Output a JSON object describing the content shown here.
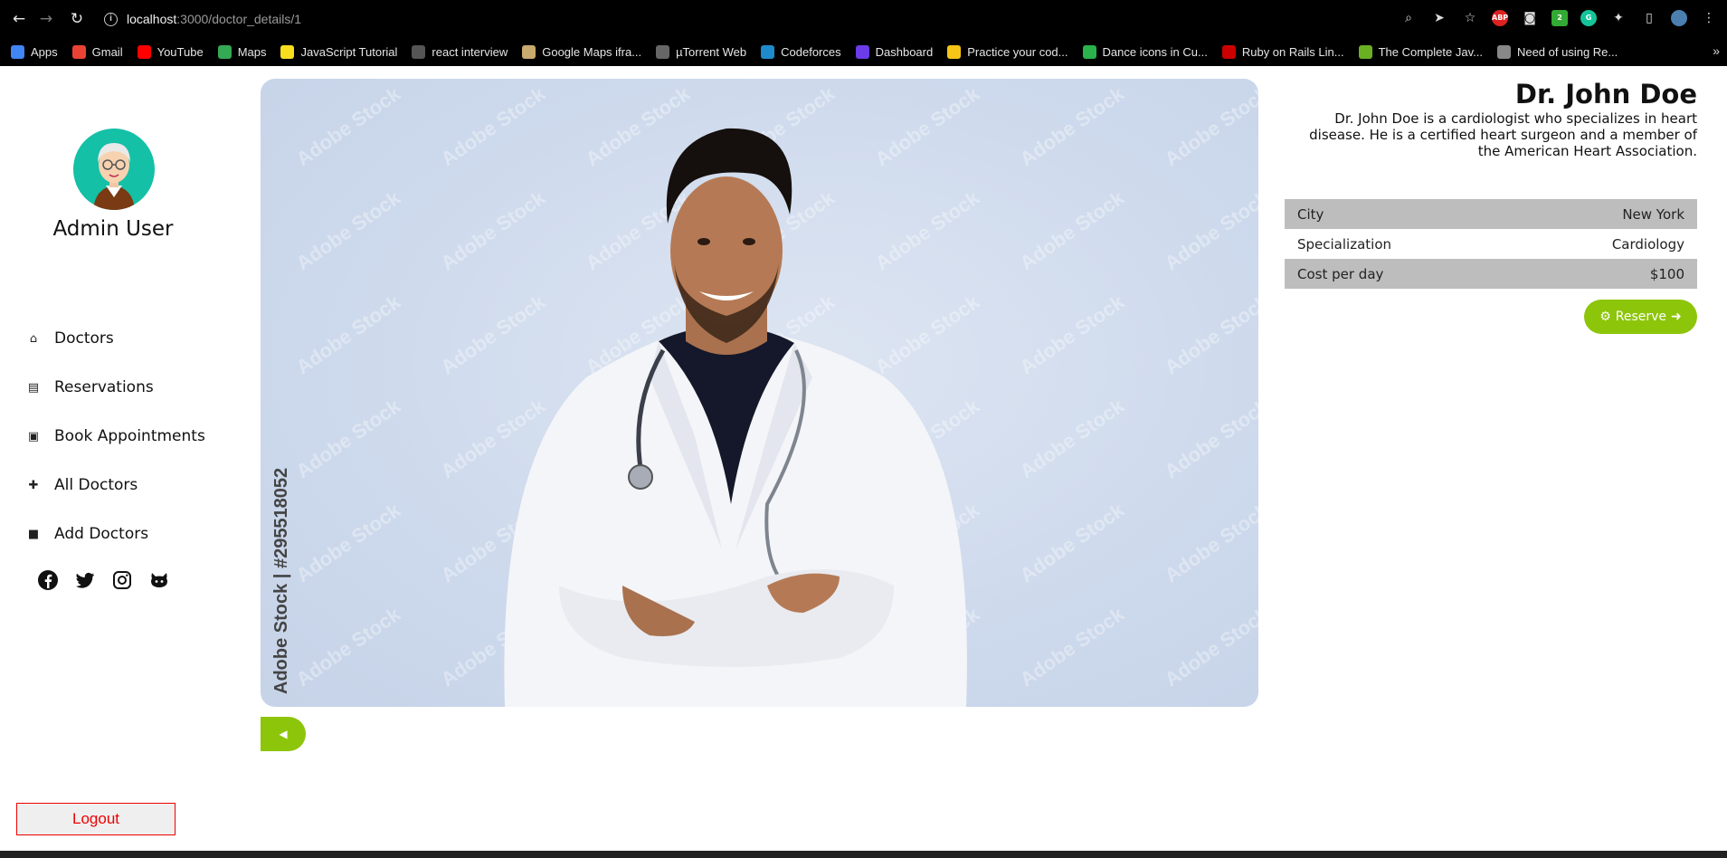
{
  "browser": {
    "url_host": "localhost",
    "url_path": ":3000/doctor_details/1",
    "bookmarks": [
      {
        "label": "Apps",
        "color": "#4285f4"
      },
      {
        "label": "Gmail",
        "color": "#ea4335"
      },
      {
        "label": "YouTube",
        "color": "#ff0000"
      },
      {
        "label": "Maps",
        "color": "#34a853"
      },
      {
        "label": "JavaScript Tutorial",
        "color": "#f7df1e"
      },
      {
        "label": "react interview",
        "color": "#555555"
      },
      {
        "label": "Google Maps ifra...",
        "color": "#c8a96e"
      },
      {
        "label": "µTorrent Web",
        "color": "#666666"
      },
      {
        "label": "Codeforces",
        "color": "#1f8acb"
      },
      {
        "label": "Dashboard",
        "color": "#6a3de8"
      },
      {
        "label": "Practice your cod...",
        "color": "#f5c518"
      },
      {
        "label": "Dance icons in Cu...",
        "color": "#2bb24c"
      },
      {
        "label": "Ruby on Rails Lin...",
        "color": "#cc0000"
      },
      {
        "label": "The Complete Jav...",
        "color": "#6ab023"
      },
      {
        "label": "Need of using Re...",
        "color": "#888888"
      }
    ]
  },
  "sidebar": {
    "user_name": "Admin User",
    "nav": [
      {
        "label": "Doctors",
        "icon": "home-icon",
        "glyph": "⌂"
      },
      {
        "label": "Reservations",
        "icon": "book-icon",
        "glyph": "▤"
      },
      {
        "label": "Book Appointments",
        "icon": "inbox-icon",
        "glyph": "▣"
      },
      {
        "label": "All Doctors",
        "icon": "medkit-icon",
        "glyph": "✚"
      },
      {
        "label": "Add Doctors",
        "icon": "bag-icon",
        "glyph": "■"
      }
    ],
    "social": [
      "facebook-icon",
      "twitter-icon",
      "instagram-icon",
      "github-icon"
    ],
    "logout_label": "Logout"
  },
  "photo": {
    "watermark_side": "Adobe Stock | #295518052",
    "watermark_tile": "Adobe Stock"
  },
  "doctor": {
    "name": "Dr. John Doe",
    "description": "Dr. John Doe is a cardiologist who specializes in heart disease. He is a certified heart surgeon and a member of the American Heart Association.",
    "details": [
      {
        "label": "City",
        "value": "New York"
      },
      {
        "label": "Specialization",
        "value": "Cardiology"
      },
      {
        "label": "Cost per day",
        "value": "$100"
      }
    ],
    "reserve_label": "Reserve"
  },
  "colors": {
    "accent": "#8dc50a",
    "logout": "#e00000",
    "avatar_bg": "#14c0a6"
  }
}
